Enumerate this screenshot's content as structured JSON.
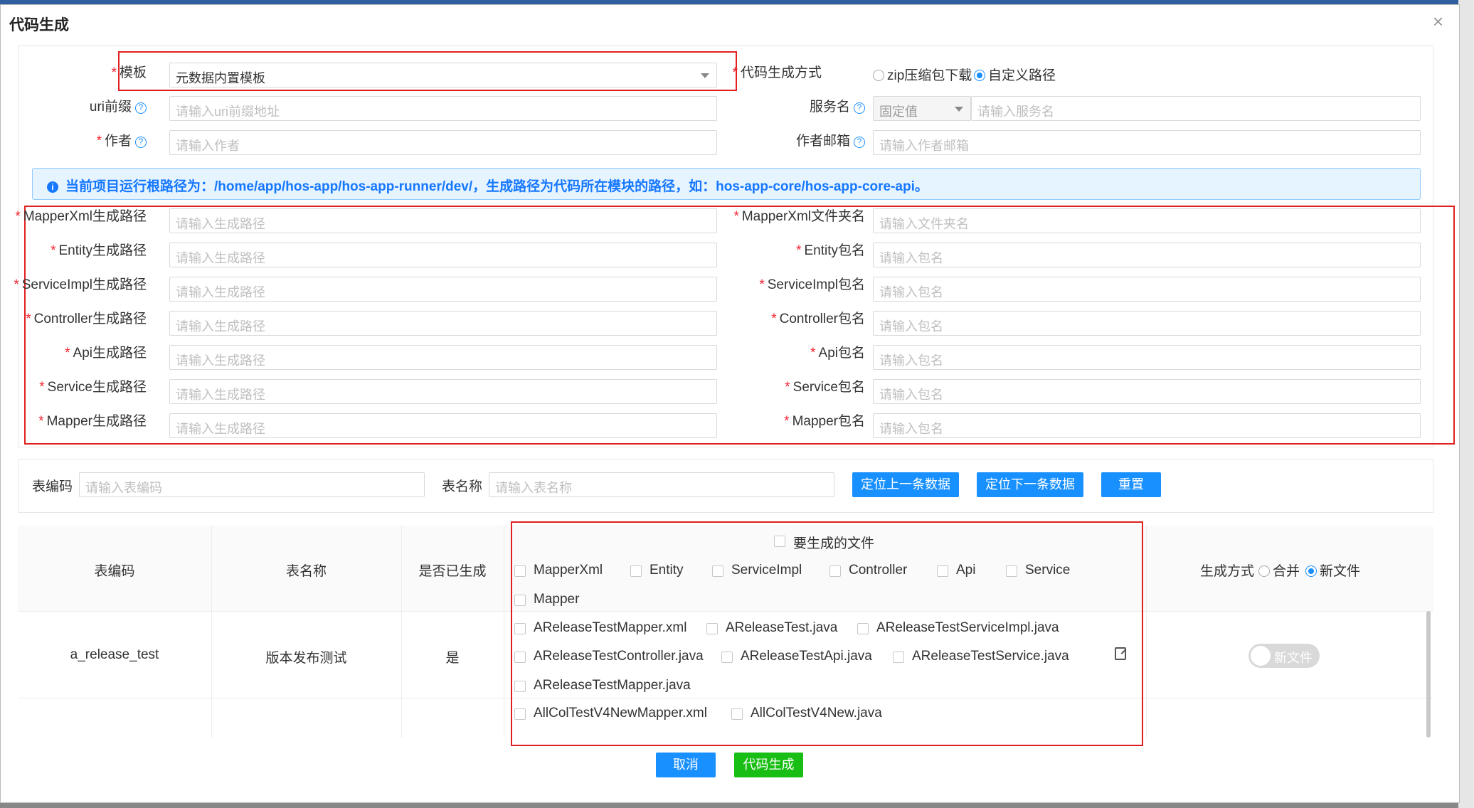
{
  "dialog": {
    "title": "代码生成",
    "close": "×"
  },
  "form": {
    "template": {
      "label": "模板",
      "value": "元数据内置模板"
    },
    "gen_mode": {
      "label": "代码生成方式",
      "opt_zip": "zip压缩包下载",
      "opt_custom": "自定义路径"
    },
    "uri_prefix": {
      "label": "uri前缀",
      "placeholder": "请输入uri前缀地址"
    },
    "service_name": {
      "label": "服务名",
      "select_value": "固定值",
      "placeholder": "请输入服务名"
    },
    "author": {
      "label": "作者",
      "placeholder": "请输入作者"
    },
    "author_email": {
      "label": "作者邮箱",
      "placeholder": "请输入作者邮箱"
    }
  },
  "alert": {
    "text": "当前项目运行根路径为：/home/app/hos-app/hos-app-runner/dev/，生成路径为代码所在模块的路径，如：hos-app-core/hos-app-core-api。"
  },
  "paths": {
    "left": [
      {
        "label": "MapperXml生成路径",
        "placeholder": "请输入生成路径"
      },
      {
        "label": "Entity生成路径",
        "placeholder": "请输入生成路径"
      },
      {
        "label": "ServiceImpl生成路径",
        "placeholder": "请输入生成路径"
      },
      {
        "label": "Controller生成路径",
        "placeholder": "请输入生成路径"
      },
      {
        "label": "Api生成路径",
        "placeholder": "请输入生成路径"
      },
      {
        "label": "Service生成路径",
        "placeholder": "请输入生成路径"
      },
      {
        "label": "Mapper生成路径",
        "placeholder": "请输入生成路径"
      }
    ],
    "right": [
      {
        "label": "MapperXml文件夹名",
        "placeholder": "请输入文件夹名"
      },
      {
        "label": "Entity包名",
        "placeholder": "请输入包名"
      },
      {
        "label": "ServiceImpl包名",
        "placeholder": "请输入包名"
      },
      {
        "label": "Controller包名",
        "placeholder": "请输入包名"
      },
      {
        "label": "Api包名",
        "placeholder": "请输入包名"
      },
      {
        "label": "Service包名",
        "placeholder": "请输入包名"
      },
      {
        "label": "Mapper包名",
        "placeholder": "请输入包名"
      }
    ]
  },
  "search": {
    "code_label": "表编码",
    "code_placeholder": "请输入表编码",
    "name_label": "表名称",
    "name_placeholder": "请输入表名称",
    "prev_button": "定位上一条数据",
    "next_button": "定位下一条数据",
    "reset_button": "重置"
  },
  "table": {
    "headers": {
      "code": "表编码",
      "name": "表名称",
      "generated": "是否已生成",
      "files": "要生成的文件",
      "method": "生成方式",
      "merge": "合并",
      "newfile": "新文件"
    },
    "header_files": [
      "MapperXml",
      "Entity",
      "ServiceImpl",
      "Controller",
      "Api",
      "Service",
      "Mapper"
    ],
    "rows": [
      {
        "code": "a_release_test",
        "name": "版本发布测试",
        "generated": "是",
        "files": [
          "AReleaseTestMapper.xml",
          "AReleaseTest.java",
          "AReleaseTestServiceImpl.java",
          "AReleaseTestController.java",
          "AReleaseTestApi.java",
          "AReleaseTestService.java",
          "AReleaseTestMapper.java"
        ],
        "toggle": "新文件"
      },
      {
        "code": "",
        "name": "",
        "generated": "",
        "files": [
          "AllColTestV4NewMapper.xml",
          "AllColTestV4New.java"
        ]
      }
    ]
  },
  "footer": {
    "cancel": "取消",
    "generate": "代码生成"
  },
  "colors": {
    "primary": "#1890ff",
    "success": "#19be14",
    "highlight_box": "#e02020"
  }
}
